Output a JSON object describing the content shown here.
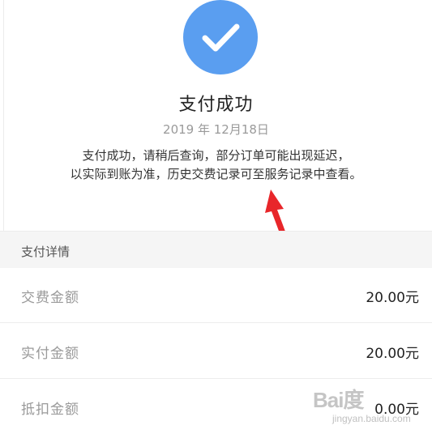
{
  "result": {
    "title": "支付成功",
    "date": "2019 年 12月18日",
    "note_line1": "支付成功，请稍后查询，部分订单可能出现延迟，",
    "note_line2": "以实际到账为准，历史交费记录可至服务记录中查看。"
  },
  "details": {
    "section_title": "支付详情",
    "rows": [
      {
        "label": "交费金额",
        "value": "20.00元"
      },
      {
        "label": "实付金额",
        "value": "20.00元"
      },
      {
        "label": "抵扣金额",
        "value": "0.00元"
      }
    ]
  },
  "watermark": {
    "brand": "Bai度",
    "sub": "jingyan.baidu.com"
  },
  "icons": {
    "success": "checkmark-icon",
    "annotation": "red-arrow-icon"
  },
  "colors": {
    "success_blue": "#5a9ef0",
    "arrow_red": "#e8262a",
    "section_bg": "#f5f5f5"
  }
}
